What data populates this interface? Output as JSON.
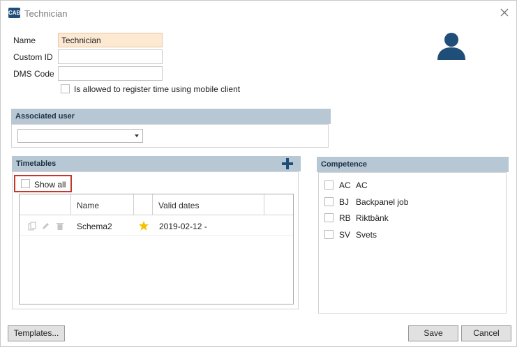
{
  "window": {
    "title": "Technician",
    "logo_text": "CAB"
  },
  "form": {
    "name_label": "Name",
    "name_value": "Technician",
    "custom_id_label": "Custom ID",
    "custom_id_value": "",
    "dms_code_label": "DMS Code",
    "dms_code_value": "",
    "mobile_checkbox_label": "Is allowed to register time using mobile client",
    "mobile_checked": false
  },
  "associated_user": {
    "header": "Associated user",
    "selected": ""
  },
  "timetables": {
    "header": "Timetables",
    "show_all_label": "Show all",
    "columns": [
      "Name",
      "Valid dates"
    ],
    "rows": [
      {
        "name": "Schema2",
        "valid_dates": "2019-02-12 -",
        "is_default": true
      }
    ]
  },
  "competence": {
    "header": "Competence",
    "items": [
      {
        "code": "AC",
        "name": "AC"
      },
      {
        "code": "BJ",
        "name": "Backpanel job"
      },
      {
        "code": "RB",
        "name": "Riktbänk"
      },
      {
        "code": "SV",
        "name": "Svets"
      }
    ]
  },
  "buttons": {
    "templates": "Templates...",
    "save": "Save",
    "cancel": "Cancel"
  },
  "colors": {
    "header_bg": "#b7c7d3",
    "accent": "#1f4e79",
    "highlight_field": "#fde8d2",
    "star": "#f2c200",
    "show_all_outline": "#c0392b"
  },
  "icons": {
    "user": "user-silhouette-icon",
    "add": "plus-icon",
    "close": "close-icon",
    "star": "star-icon"
  }
}
